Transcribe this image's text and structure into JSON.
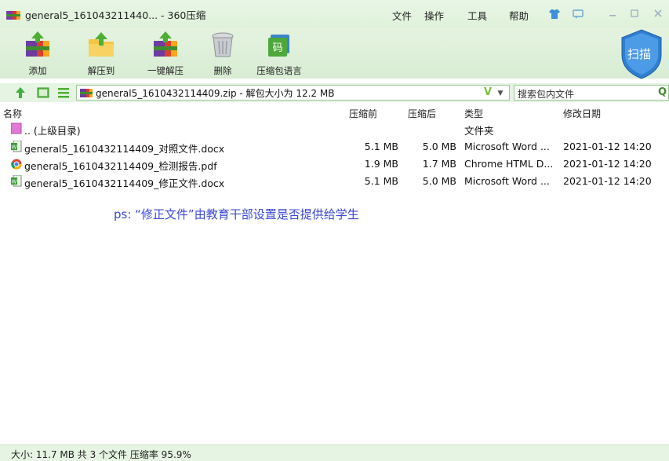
{
  "window": {
    "title": "general5_161043211440... - 360压缩",
    "menu": [
      "文件",
      "操作",
      "工具",
      "帮助"
    ]
  },
  "toolbar": {
    "buttons": [
      {
        "label": "添加",
        "icon": "add-archive-icon"
      },
      {
        "label": "解压到",
        "icon": "extract-to-folder-icon"
      },
      {
        "label": "一键解压",
        "icon": "one-click-extract-icon"
      },
      {
        "label": "删除",
        "icon": "trash-icon"
      },
      {
        "label": "压缩包语言",
        "icon": "archive-language-icon"
      }
    ],
    "language_icon_text": "码",
    "scan_label": "扫描"
  },
  "address": {
    "path": "general5_1610432114409.zip - 解包大小为 12.2 MB",
    "verify_badge": "V",
    "search_placeholder": "搜索包内文件",
    "search_icon_text": "Q"
  },
  "columns": {
    "name": "名称",
    "before": "压缩前",
    "after": "压缩后",
    "type": "类型",
    "date": "修改日期"
  },
  "files": [
    {
      "name": ".. (上级目录)",
      "before": "",
      "after": "",
      "type": "文件夹",
      "date": "",
      "icon": "folder-icon"
    },
    {
      "name": "general5_1610432114409_对照文件.docx",
      "before": "5.1 MB",
      "after": "5.0 MB",
      "type": "Microsoft Word ...",
      "date": "2021-01-12 14:20",
      "icon": "word-doc-icon"
    },
    {
      "name": "general5_1610432114409_检测报告.pdf",
      "before": "1.9 MB",
      "after": "1.7 MB",
      "type": "Chrome HTML D...",
      "date": "2021-01-12 14:20",
      "icon": "chrome-icon"
    },
    {
      "name": "general5_1610432114409_修正文件.docx",
      "before": "5.1 MB",
      "after": "5.0 MB",
      "type": "Microsoft Word ...",
      "date": "2021-01-12 14:20",
      "icon": "word-doc-icon"
    }
  ],
  "note": "ps: “修正文件”由教育干部设置是否提供给学生",
  "status": "大小: 11.7 MB 共 3 个文件 压缩率 95.9%",
  "colors": {
    "chrome_bg": "#e2f2de",
    "note_text": "#3a47d6",
    "accent_blue": "#3c8fd8"
  }
}
